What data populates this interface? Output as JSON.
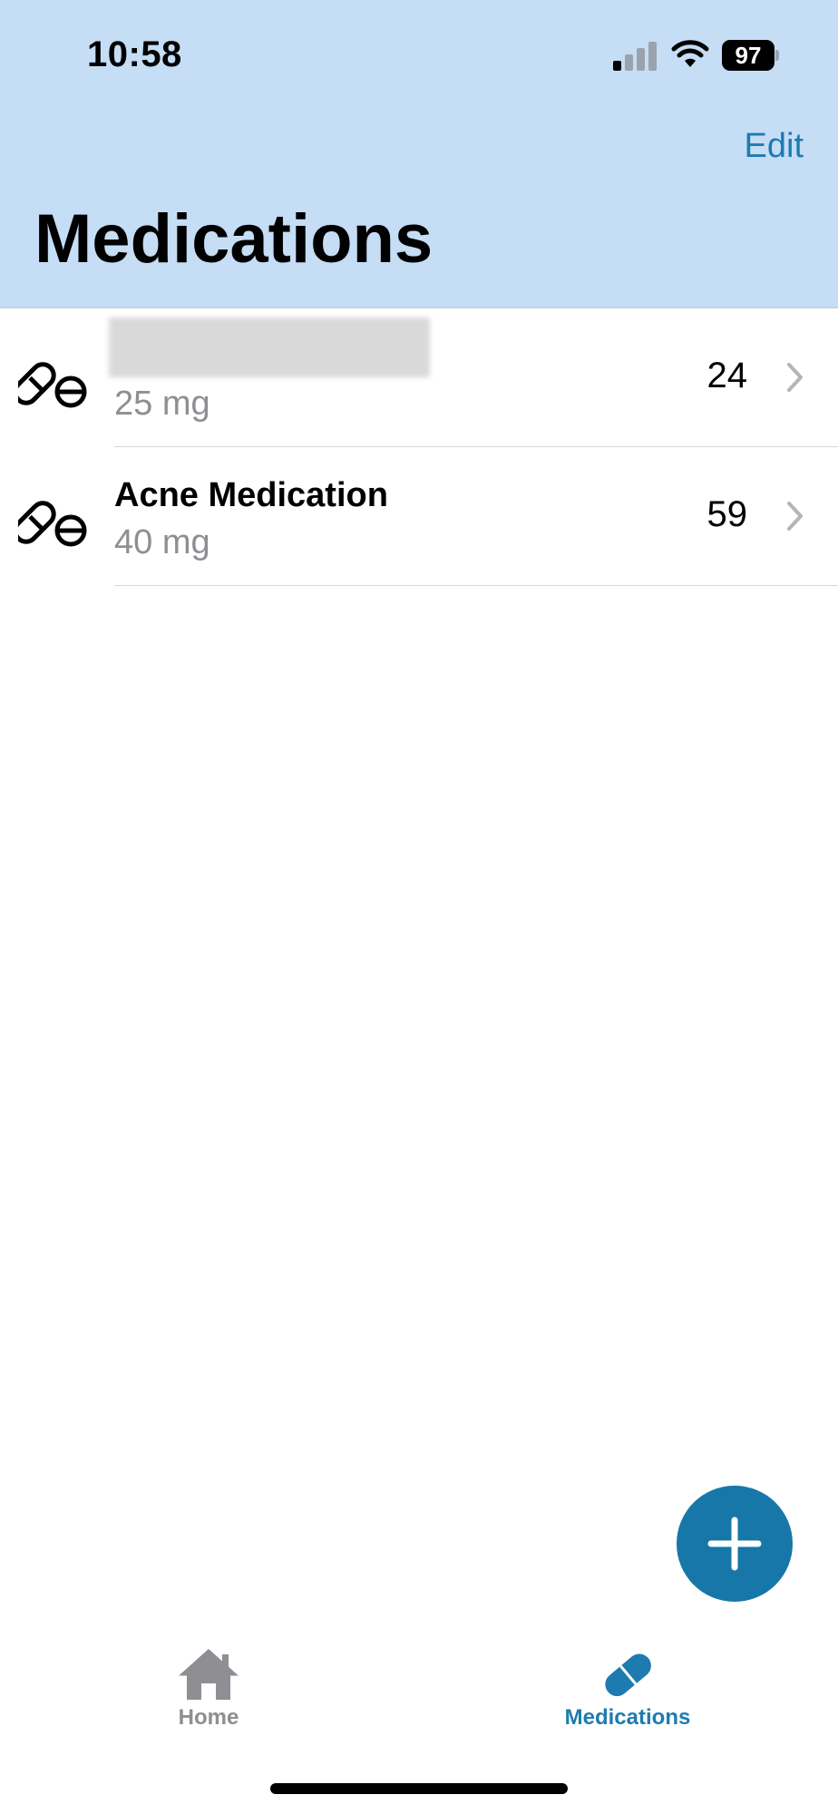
{
  "status_bar": {
    "time": "10:58",
    "battery": "97",
    "icons": [
      "cellular-signal-icon",
      "wifi-icon",
      "battery-icon"
    ]
  },
  "nav": {
    "edit_label": "Edit",
    "title": "Medications"
  },
  "medications": [
    {
      "name": "",
      "name_redacted": true,
      "dose": "25 mg",
      "count": "24",
      "icon": "pills-icon"
    },
    {
      "name": "Acne Medication",
      "name_redacted": false,
      "dose": "40 mg",
      "count": "59",
      "icon": "pills-icon"
    }
  ],
  "fab": {
    "icon": "plus-icon"
  },
  "tabs": [
    {
      "label": "Home",
      "icon": "house-icon",
      "selected": false
    },
    {
      "label": "Medications",
      "icon": "pill-icon",
      "selected": true
    }
  ],
  "colors": {
    "header_bg": "#c5ddf5",
    "accent": "#1e7bb0",
    "fab": "#1677a8",
    "secondary_text": "#8e8e93"
  }
}
